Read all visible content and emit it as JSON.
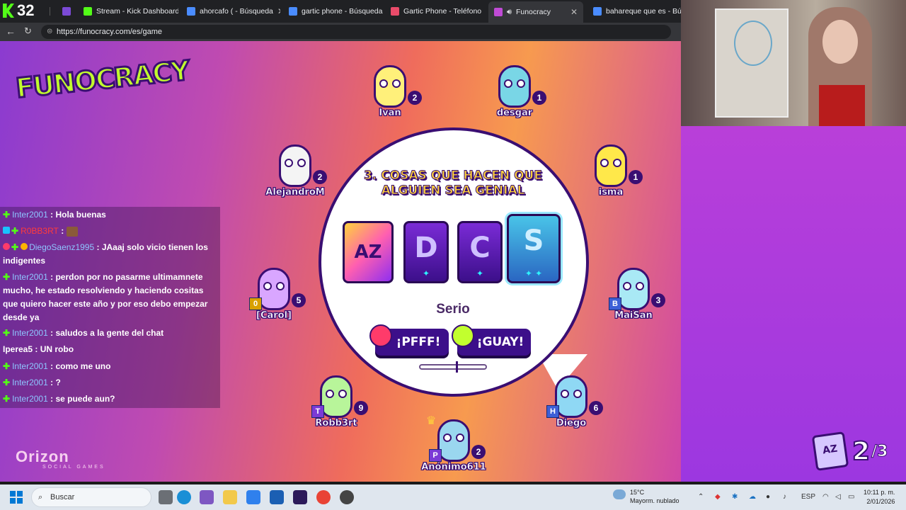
{
  "browser": {
    "tab_count": "32",
    "tabs": [
      {
        "label": "Stream - Kick Dashboard",
        "fav_color": "#53fc18"
      },
      {
        "label": "ahorcafo ( - Búsqueda",
        "fav_color": "#4a8cff"
      },
      {
        "label": "gartic phone - Búsqueda",
        "fav_color": "#4a8cff"
      },
      {
        "label": "Gartic Phone - Teléfono",
        "fav_color": "#e94b6a"
      },
      {
        "label": "Funocracy",
        "fav_color": "#c04bd6"
      },
      {
        "label": "bahareque que es - Búsq",
        "fav_color": "#4a8cff"
      }
    ],
    "url": "https://funocracy.com/es/game"
  },
  "game": {
    "logo": "FUNOCRACY",
    "question": "3. COSAS QUE HACEN QUE ALGUIEN SEA GENIAL",
    "cards": [
      {
        "label": "AZ",
        "kind": "az"
      },
      {
        "label": "D",
        "stars": "✦"
      },
      {
        "label": "C",
        "stars": "✦"
      },
      {
        "label": "S",
        "stars": "✦ ✦"
      }
    ],
    "mode": "Serio",
    "vote_no": "¡PFFF!",
    "vote_yes": "¡GUAY!",
    "round_current": "2",
    "round_total": "/3",
    "round_icon": "AZ",
    "brand": "Orizon",
    "brand_sub": "SOCIAL GAMES",
    "colors": {
      "accent": "#3a0e72",
      "title_yellow": "#ffd23c",
      "lime": "#c2ff2e"
    }
  },
  "players": [
    {
      "name": "Ivan",
      "score": "2",
      "color": "#fff07a"
    },
    {
      "name": "desgar",
      "score": "1",
      "color": "#79d6e6"
    },
    {
      "name": "AlejandroM",
      "score": "2",
      "color": "#f4f4f4"
    },
    {
      "name": "isma",
      "score": "1",
      "color": "#ffe84a"
    },
    {
      "name": "[Carol]",
      "score": "5",
      "letter": "0",
      "color": "#d9a6ff"
    },
    {
      "name": "MaiSan",
      "score": "3",
      "letter": "B",
      "color": "#a9e9f5"
    },
    {
      "name": "Robb3rt",
      "score": "9",
      "letter": "T",
      "color": "#b8f59a"
    },
    {
      "name": "Diego",
      "score": "6",
      "letter": "H",
      "color": "#8fd8f4"
    },
    {
      "name": "Anónimo611",
      "score": "2",
      "letter": "P",
      "color": "#9ad7ef"
    }
  ],
  "chat": [
    {
      "user": "Inter2001",
      "text": ": Hola buenas"
    },
    {
      "user": "R0BB3RT",
      "text": ":"
    },
    {
      "user": "DiegoSaenz1995",
      "text": ": JAaaj solo vicio tienen los indigentes"
    },
    {
      "user": "Inter2001",
      "text": ": perdon por no pasarme ultimamnete mucho, he estado resolviendo y haciendo cositas que quiero hacer este año y por eso debo empezar desde ya"
    },
    {
      "user": "Inter2001",
      "text": ": saludos a la gente del chat"
    },
    {
      "user": "Iperea5",
      "text": ": UN robo"
    },
    {
      "user": "Inter2001",
      "text": ": como me uno"
    },
    {
      "user": "Inter2001",
      "text": ": ?"
    },
    {
      "user": "Inter2001",
      "text": ": se puede aun?"
    }
  ],
  "taskbar": {
    "search": "Buscar",
    "weather_temp": "15°C",
    "weather_desc": "Mayorm. nublado",
    "lang": "ESP",
    "time": "10:11 p. m.",
    "date": "2/01/2026"
  }
}
